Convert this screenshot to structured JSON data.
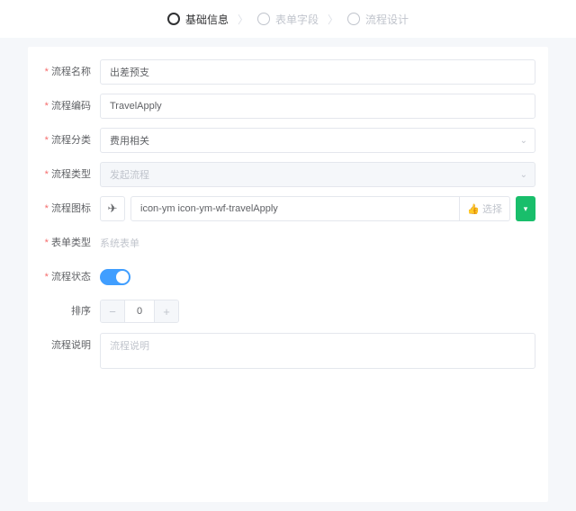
{
  "steps": {
    "basic": "基础信息",
    "fields": "表单字段",
    "flow": "流程设计"
  },
  "labels": {
    "name": "流程名称",
    "code": "流程编码",
    "category": "流程分类",
    "type": "流程类型",
    "icon": "流程图标",
    "formType": "表单类型",
    "status": "流程状态",
    "sort": "排序",
    "desc": "流程说明"
  },
  "values": {
    "name": "出差预支",
    "code": "TravelApply",
    "category": "费用相关",
    "type": "发起流程",
    "iconClass": "icon-ym icon-ym-wf-travelApply",
    "formType": "系统表单",
    "sort": "0"
  },
  "actions": {
    "selectIcon": "选择"
  },
  "placeholders": {
    "desc": "流程说明"
  }
}
